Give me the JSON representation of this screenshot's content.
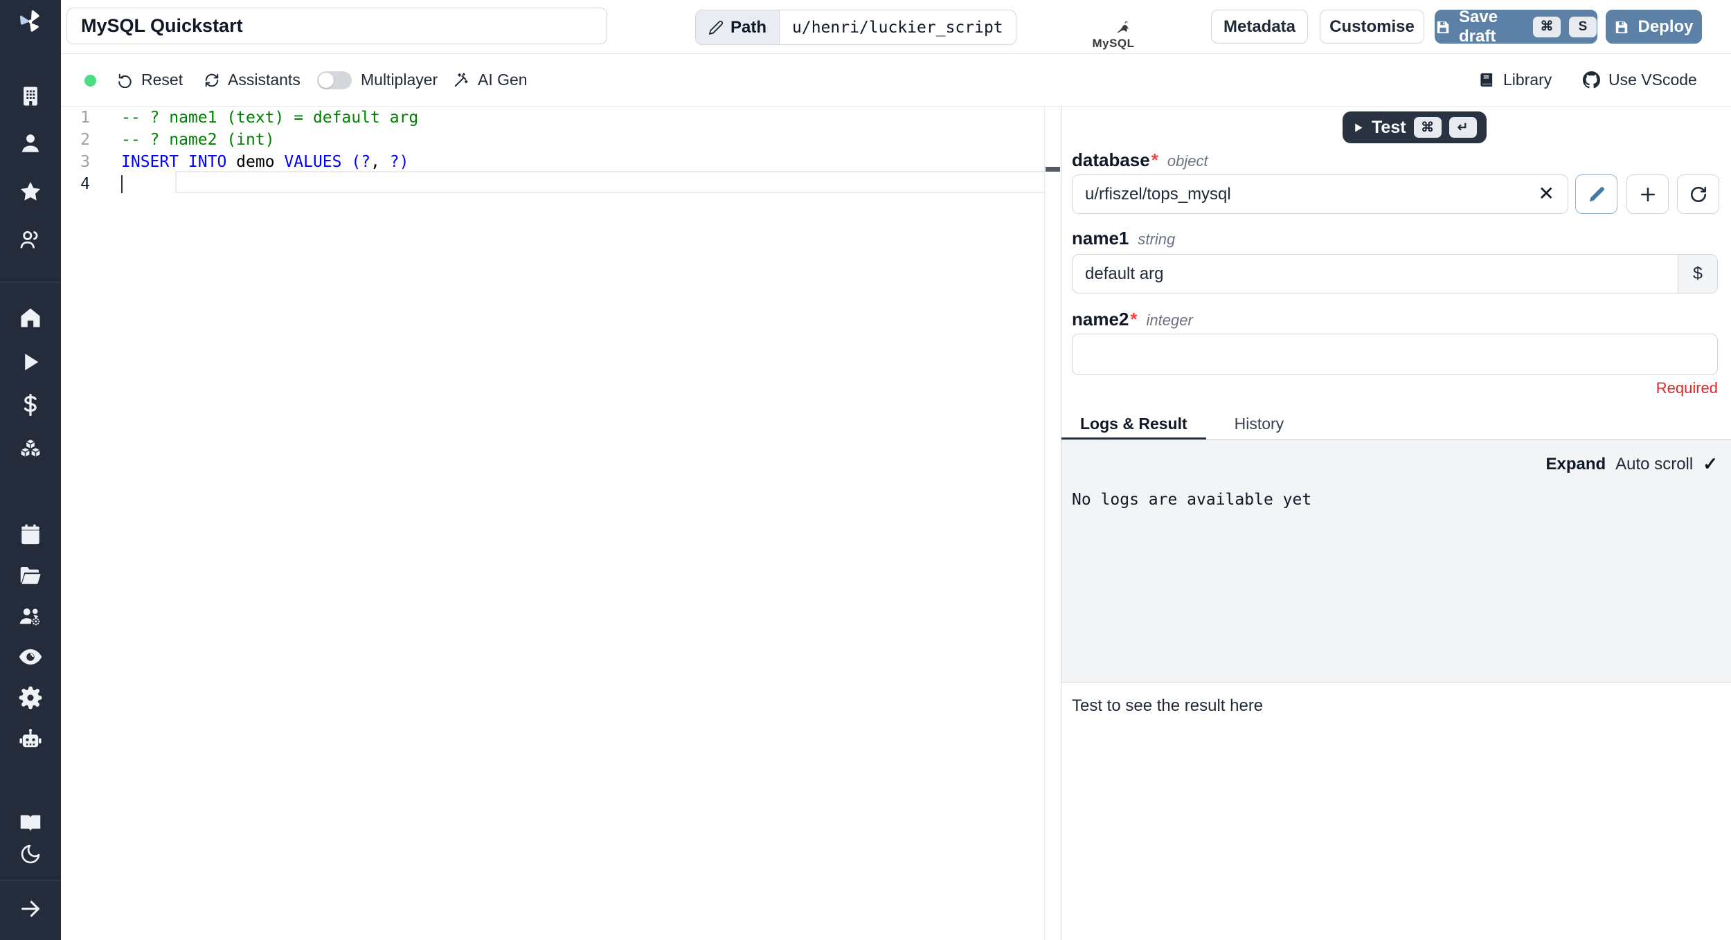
{
  "colors": {
    "sidebar_bg": "#242b3a",
    "accent_blue_button": "#5d80a6",
    "dark_button": "#2a3342",
    "status_green": "#4ade80",
    "error_red": "#dc2626",
    "comment_green": "#008000",
    "keyword_blue": "#0000ff",
    "logs_bg": "#f3f4f6"
  },
  "icons": {
    "check": "✓",
    "close": "✕",
    "kbd_cmd": "⌘",
    "kbd_enter": "↵"
  },
  "topbar": {
    "title_value": "MySQL Quickstart",
    "path_label": "Path",
    "path_value": "u/henri/luckier_script",
    "language_logo": "MySQL",
    "metadata_label": "Metadata",
    "customise_label": "Customise",
    "save_draft_label": "Save draft",
    "save_kbd_mod": "⌘",
    "save_kbd_key": "S",
    "deploy_label": "Deploy"
  },
  "toolbar": {
    "reset_label": "Reset",
    "assistants_label": "Assistants",
    "multiplayer_label": "Multiplayer",
    "ai_gen_label": "AI Gen",
    "library_label": "Library",
    "use_vscode_label": "Use VScode"
  },
  "editor": {
    "line_numbers": [
      "1",
      "2",
      "3",
      "4"
    ],
    "lines": [
      {
        "tokens": [
          {
            "text": "-- ? name1 (text) = default arg",
            "type": "comment"
          }
        ]
      },
      {
        "tokens": [
          {
            "text": "-- ? name2 (int)",
            "type": "comment"
          }
        ]
      },
      {
        "tokens": [
          {
            "text": "INSERT INTO",
            "type": "keyword"
          },
          {
            "text": " demo ",
            "type": "plain"
          },
          {
            "text": "VALUES",
            "type": "keyword"
          },
          {
            "text": " (?",
            "type": "keyword"
          },
          {
            "text": ",",
            "type": "plain"
          },
          {
            "text": " ?)",
            "type": "keyword"
          }
        ]
      },
      {
        "tokens": []
      }
    ]
  },
  "panel": {
    "test_button": {
      "label": "Test",
      "kbd_mod": "⌘",
      "kbd_enter": "↵"
    },
    "fields": [
      {
        "name": "database",
        "star": "*",
        "type": "object",
        "value": "u/rfiszel/tops_mysql"
      },
      {
        "name": "name1",
        "star": "",
        "type": "string",
        "value": "default arg",
        "suffix": "$"
      },
      {
        "name": "name2",
        "star": "*",
        "type": "integer",
        "value": "",
        "error": "Required"
      }
    ],
    "tabs": [
      {
        "label": "Logs & Result"
      },
      {
        "label": "History"
      }
    ],
    "logs": {
      "expand_label": "Expand",
      "auto_scroll_label": "Auto scroll",
      "empty_text": "No logs are available yet"
    },
    "result_placeholder": "Test to see the result here"
  }
}
